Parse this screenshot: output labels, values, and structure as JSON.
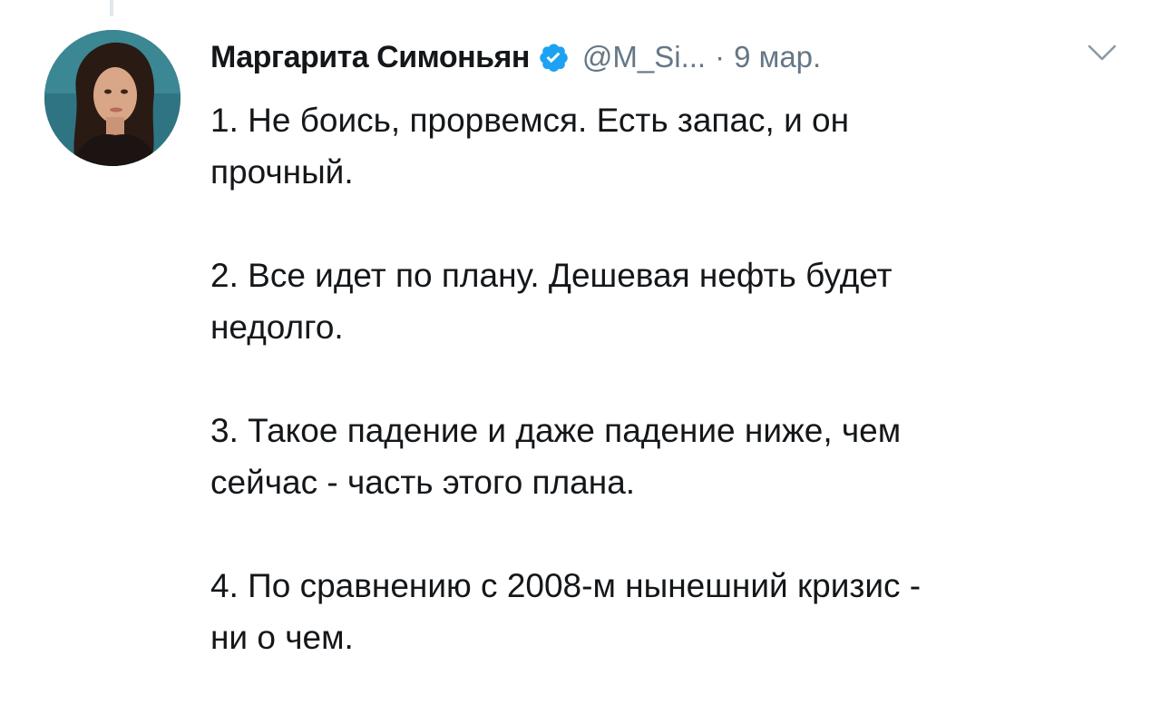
{
  "tweet": {
    "author_name": "Маргарита Симоньян",
    "handle": "@M_Si...",
    "separator": "·",
    "date": "9 мар.",
    "paragraphs": [
      "1. Не боись, прорвемся. Есть запас, и он\nпрочный.",
      "2. Все идет по плану. Дешевая нефть будет\nнедолго.",
      "3. Такое падение и даже падение ниже, чем\nсейчас - часть этого плана.",
      "4. По сравнению с 2008-м нынешний кризис -\nни о чем."
    ]
  },
  "icons": {
    "verified": "verified-badge-icon",
    "menu": "chevron-down-icon"
  },
  "colors": {
    "text_primary": "#14171a",
    "text_secondary": "#657786",
    "verified_blue": "#1da1f2",
    "thread_line": "#e1e8ed"
  }
}
